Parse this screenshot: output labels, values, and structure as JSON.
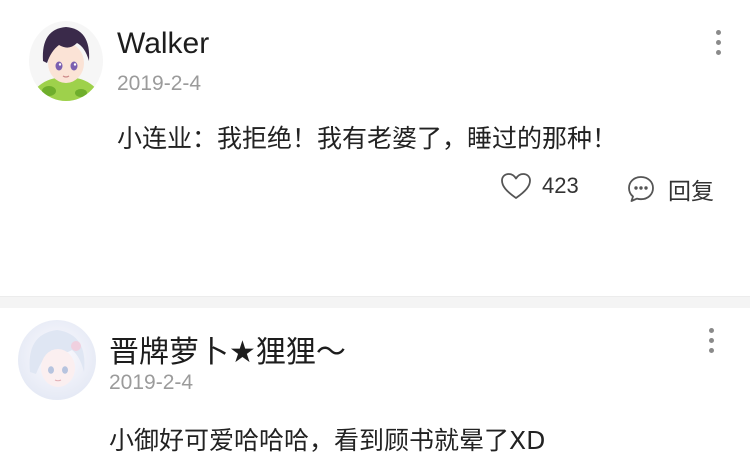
{
  "comments": [
    {
      "username": "Walker",
      "date": "2019-2-4",
      "text": "小连业：我拒绝！我有老婆了，睡过的那种！",
      "likes": "423",
      "reply_label": "回复",
      "avatar_icon": "avatar-anime-boy"
    },
    {
      "username": "晋牌萝卜★狸狸～",
      "date": "2019-2-4",
      "text": "小御好可爱哈哈哈，看到顾书就晕了XD",
      "avatar_icon": "avatar-anime-pastel"
    }
  ],
  "colors": {
    "meta_gray": "#9b9b9b",
    "text_dark": "#222222",
    "divider": "#f4f4f4"
  }
}
